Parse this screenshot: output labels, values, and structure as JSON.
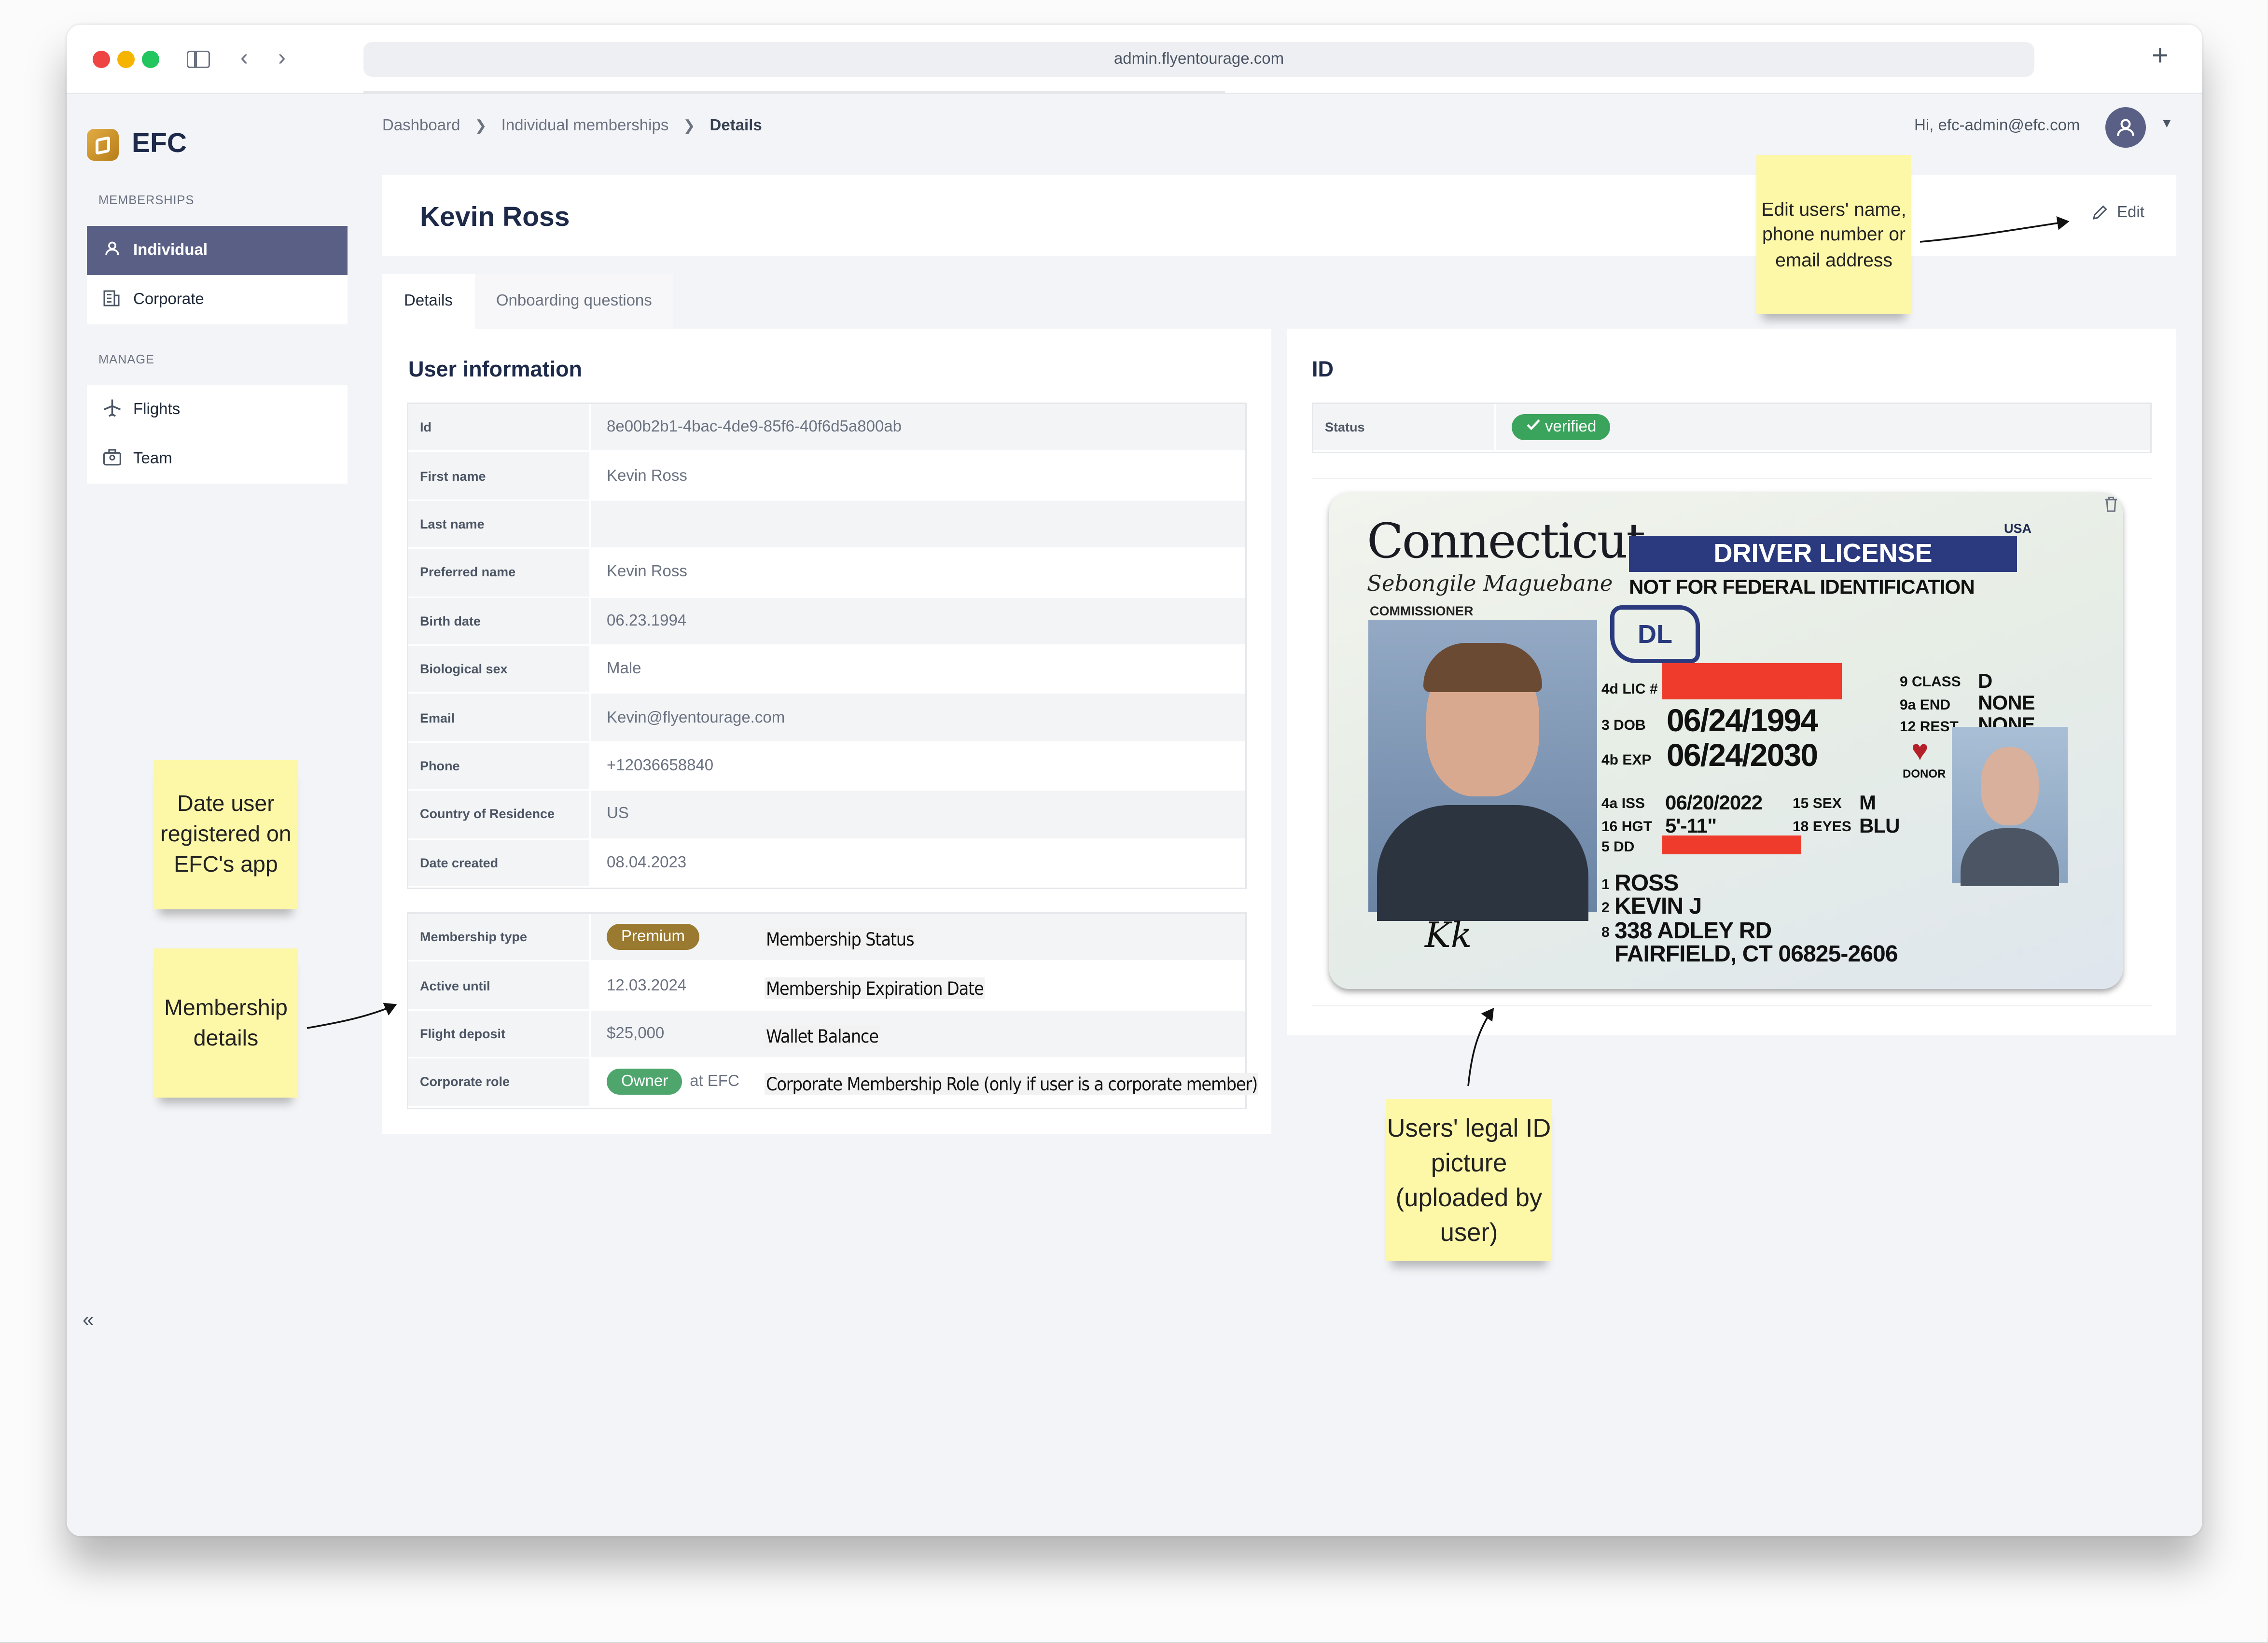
{
  "browser": {
    "url": "admin.flyentourage.com",
    "new_tab_icon": "+"
  },
  "brand": {
    "name": "EFC"
  },
  "sidebar": {
    "sections": [
      {
        "label": "MEMBERSHIPS",
        "items": [
          {
            "label": "Individual",
            "icon": "user-icon",
            "active": true
          },
          {
            "label": "Corporate",
            "icon": "building-icon",
            "active": false
          }
        ]
      },
      {
        "label": "MANAGE",
        "items": [
          {
            "label": "Flights",
            "icon": "plane-icon",
            "active": false
          },
          {
            "label": "Team",
            "icon": "team-icon",
            "active": false
          }
        ]
      }
    ],
    "collapse_icon": "«"
  },
  "header": {
    "breadcrumb": [
      "Dashboard",
      "Individual memberships",
      "Details"
    ],
    "greeting": "Hi, efc-admin@efc.com"
  },
  "page": {
    "title": "Kevin Ross",
    "edit_label": "Edit"
  },
  "tabs": [
    "Details",
    "Onboarding questions"
  ],
  "user_info": {
    "title": "User information",
    "rows": [
      {
        "key": "Id",
        "value": "8e00b2b1-4bac-4de9-85f6-40f6d5a800ab"
      },
      {
        "key": "First name",
        "value": "Kevin Ross"
      },
      {
        "key": "Last name",
        "value": ""
      },
      {
        "key": "Preferred name",
        "value": "Kevin Ross"
      },
      {
        "key": "Birth date",
        "value": "06.23.1994"
      },
      {
        "key": "Biological sex",
        "value": "Male"
      },
      {
        "key": "Email",
        "value": "Kevin@flyentourage.com"
      },
      {
        "key": "Phone",
        "value": "+12036658840"
      },
      {
        "key": "Country of Residence",
        "value": "US"
      },
      {
        "key": "Date created",
        "value": "08.04.2023"
      }
    ]
  },
  "membership": {
    "rows": [
      {
        "key": "Membership type",
        "value": "Premium"
      },
      {
        "key": "Active until",
        "value": "12.03.2024"
      },
      {
        "key": "Flight deposit",
        "value": "$25,000"
      },
      {
        "key": "Corporate role",
        "value": "Owner",
        "org_prefix": "at",
        "org": "EFC"
      }
    ],
    "annotations": [
      "Membership Status",
      "Membership Expiration Date",
      "Wallet Balance",
      "Corporate Membership Role (only if user is a corporate member)"
    ]
  },
  "id_panel": {
    "title": "ID",
    "status_key": "Status",
    "status_value": "verified",
    "license": {
      "state": "Connecticut",
      "country": "USA",
      "banner": "DRIVER LICENSE",
      "subtitle": "NOT FOR FEDERAL IDENTIFICATION",
      "commissioner_label": "COMMISSIONER",
      "commissioner_signature": "Sebongile Maguebane",
      "dl_mark": "DL",
      "lic_label": "4d LIC #",
      "dob_label": "3  DOB",
      "dob": "06/24/1994",
      "exp_label": "4b EXP",
      "exp": "06/24/2030",
      "iss_label": "4a ISS",
      "iss": "06/20/2022",
      "sex_label": "15 SEX",
      "sex": "M",
      "hgt_label": "16 HGT",
      "hgt": "5'-11\"",
      "eyes_label": "18 EYES",
      "eyes": "BLU",
      "dd_label": "5  DD",
      "class_label": "9  CLASS",
      "class": "D",
      "end_label": "9a END",
      "end": "NONE",
      "rest_label": "12 REST",
      "rest": "NONE",
      "donor_label": "DONOR",
      "surname_num": "1",
      "surname": "ROSS",
      "given_num": "2",
      "given": "KEVIN J",
      "addr_num": "8",
      "address1": "338 ADLEY RD",
      "address2": "FAIRFIELD, CT 06825-2606",
      "holder_signature": "Kk"
    }
  },
  "sticky_notes": {
    "edit": "Edit users' name, phone number or email address",
    "date_created": "Date user registered on EFC's app",
    "membership": "Membership details",
    "id_picture": "Users' legal ID picture (uploaded by user)"
  },
  "colors": {
    "sidebar_active": "#5a5f86",
    "premium": "#9a7a30",
    "owner": "#4ea66d",
    "verified": "#3aa45d",
    "sticky": "#fdf7a8",
    "brand": "#1e2a4a"
  }
}
